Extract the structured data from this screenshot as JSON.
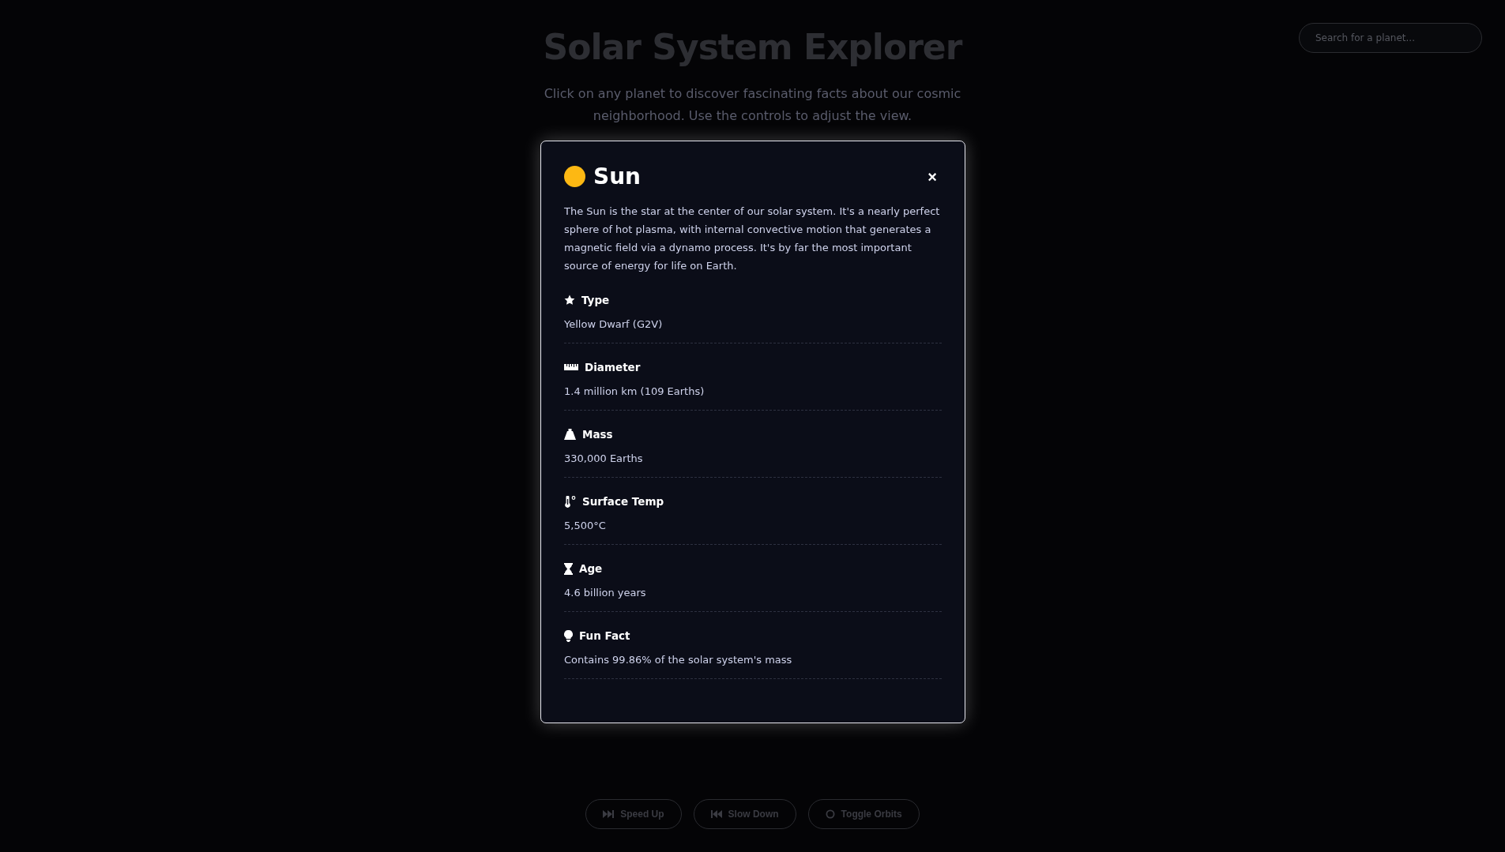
{
  "header": {
    "title": "Solar System Explorer",
    "subtitle": "Click on any planet to discover fascinating facts about our cosmic neighborhood. Use the controls to adjust the view."
  },
  "search": {
    "placeholder": "Search for a planet..."
  },
  "modal": {
    "title": "Sun",
    "color": "#fdb813",
    "close": "×",
    "description": "The Sun is the star at the center of our solar system. It's a nearly perfect sphere of hot plasma, with internal convective motion that generates a magnetic field via a dynamo process. It's by far the most important source of energy for life on Earth.",
    "facts": [
      {
        "kind": "star",
        "label": "Type",
        "value": "Yellow Dwarf (G2V)"
      },
      {
        "kind": "ruler",
        "label": "Diameter",
        "value": "1.4 million km (109 Earths)"
      },
      {
        "kind": "weight",
        "label": "Mass",
        "value": "330,000 Earths"
      },
      {
        "kind": "thermometer",
        "label": "Surface Temp",
        "value": "5,500°C"
      },
      {
        "kind": "hourglass",
        "label": "Age",
        "value": "4.6 billion years"
      },
      {
        "kind": "lightbulb",
        "label": "Fun Fact",
        "value": "Contains 99.86% of the solar system's mass"
      }
    ]
  },
  "controls": [
    {
      "kind": "forward",
      "label": "Speed Up"
    },
    {
      "kind": "backward",
      "label": "Slow Down"
    },
    {
      "kind": "circle",
      "label": "Toggle Orbits"
    }
  ]
}
